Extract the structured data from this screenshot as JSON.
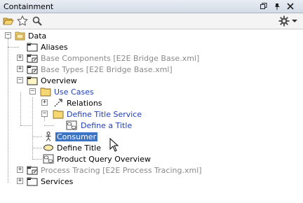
{
  "window": {
    "title": "Containment"
  },
  "icons": {
    "restore": "restore-icon",
    "pin": "pin-icon",
    "close": "close-icon",
    "open_folder": "open-folder-icon",
    "favorite": "star-icon",
    "search": "search-icon",
    "settings": "gear-icon",
    "dropdown": "chevron-down-icon"
  },
  "colors": {
    "selection": "#3b73c5",
    "link_blue": "#1f3fb5",
    "grey_text": "#8a8a8a",
    "folder": "#f7d774"
  },
  "tree": {
    "data": "Data",
    "aliases": "Aliases",
    "base_components": "Base Components [E2E Bridge Base.xml]",
    "base_types": "Base Types [E2E Bridge Base.xml]",
    "overview": "Overview",
    "use_cases": "Use Cases",
    "relations": "Relations",
    "define_title_service": "Define Title Service",
    "define_a_title": "Define a Title",
    "consumer": "Consumer",
    "define_title": "Define Title",
    "product_query_overview": "Product Query Overview",
    "process_tracing": "Process Tracing [E2E Process Tracing.xml]",
    "services": "Services"
  }
}
